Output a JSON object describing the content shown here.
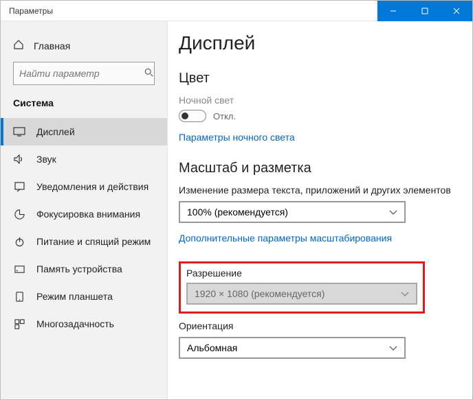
{
  "window": {
    "title": "Параметры"
  },
  "sidebar": {
    "home": "Главная",
    "search_placeholder": "Найти параметр",
    "section": "Система",
    "items": [
      {
        "label": "Дисплей"
      },
      {
        "label": "Звук"
      },
      {
        "label": "Уведомления и действия"
      },
      {
        "label": "Фокусировка внимания"
      },
      {
        "label": "Питание и спящий режим"
      },
      {
        "label": "Память устройства"
      },
      {
        "label": "Режим планшета"
      },
      {
        "label": "Многозадачность"
      }
    ]
  },
  "main": {
    "title": "Дисплей",
    "color_heading": "Цвет",
    "night_light_label": "Ночной свет",
    "night_light_state": "Откл.",
    "night_light_link": "Параметры ночного света",
    "scale_heading": "Масштаб и разметка",
    "scale_label": "Изменение размера текста, приложений и других элементов",
    "scale_value": "100% (рекомендуется)",
    "scale_link": "Дополнительные параметры масштабирования",
    "resolution_label": "Разрешение",
    "resolution_value": "1920 × 1080 (рекомендуется)",
    "orientation_label": "Ориентация",
    "orientation_value": "Альбомная"
  }
}
